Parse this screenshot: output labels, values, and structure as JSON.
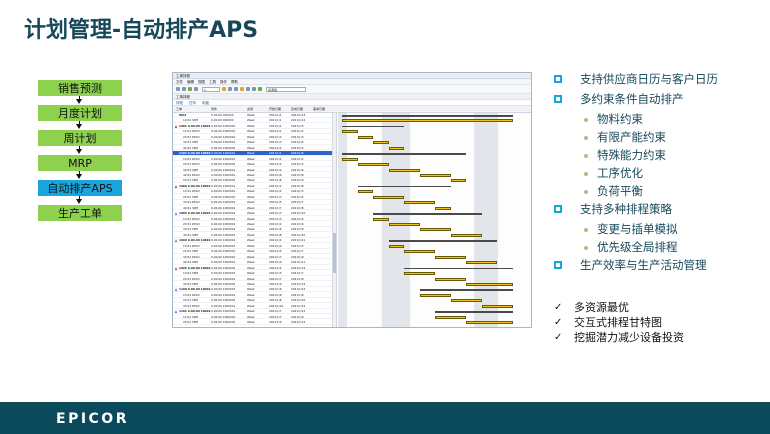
{
  "title": "计划管理-自动排产APS",
  "flow": {
    "steps": [
      "销售预测",
      "月度计划",
      "周计划",
      "MRP",
      "自动排产APS",
      "生产工单"
    ],
    "active_index": 4
  },
  "screenshot": {
    "window_title": "工单排程",
    "menu": [
      "文件",
      "编辑",
      "视图",
      "工具",
      "操作",
      "帮助"
    ],
    "combo1": "1",
    "combo2": "资源组",
    "subtitle": "工单排程",
    "tabs": [
      "排程",
      "甘特",
      "明细"
    ],
    "columns": [
      "工单",
      "零件",
      "资源",
      "开始日期",
      "完成日期",
      "需求日期"
    ],
    "rows": [
      {
        "c0": "WO1",
        "c1": "0-00-00 000000",
        "c2": "Week",
        "c3": "2021/1/1",
        "c4": "2021/1/12",
        "c5": "",
        "parent": true
      },
      {
        "c0": "10 R1 SPM",
        "c1": "0-00-00 000000",
        "c2": "Week",
        "c3": "2021/1/1",
        "c4": "2021/1/12",
        "c5": ""
      },
      {
        "c0": "1081 0-00-00 10001",
        "c1": "0-00-00 1000001",
        "c2": "Week",
        "c3": "2021/1/1",
        "c4": "2021/1/5",
        "c5": "",
        "parent": true,
        "warn": "red"
      },
      {
        "c0": "10 R1 RPG3",
        "c1": "0-00-00 1000001",
        "c2": "Week",
        "c3": "2021/1/1",
        "c4": "2021/1/2",
        "c5": ""
      },
      {
        "c0": "20 R1 RPG3",
        "c1": "0-00-00 1000001",
        "c2": "Week",
        "c3": "2021/1/2",
        "c4": "2021/1/3",
        "c5": ""
      },
      {
        "c0": "30 R1 SPM",
        "c1": "0-00-00 1000001",
        "c2": "Week",
        "c3": "2021/1/3",
        "c4": "2021/1/4",
        "c5": ""
      },
      {
        "c0": "40 R1 SPM",
        "c1": "0-00-00 1000001",
        "c2": "Week",
        "c3": "2021/1/4",
        "c4": "2021/1/5",
        "c5": ""
      },
      {
        "c0": "1102 0-00-00 10001",
        "c1": "0-00-00 1000001",
        "c2": "Week",
        "c3": "2021/1/1",
        "c4": "2021/1/9",
        "c5": "",
        "parent": true,
        "hl": true
      },
      {
        "c0": "10 R1 RPG3",
        "c1": "0-00-00 1000001",
        "c2": "Week",
        "c3": "2021/1/1",
        "c4": "2021/1/2",
        "c5": ""
      },
      {
        "c0": "20 R1 RPG3",
        "c1": "0-00-00 1000001",
        "c2": "Week",
        "c3": "2021/1/2",
        "c4": "2021/1/4",
        "c5": ""
      },
      {
        "c0": "30 R1 SPM",
        "c1": "0-00-00 1000001",
        "c2": "Week",
        "c3": "2021/1/4",
        "c4": "2021/1/6",
        "c5": ""
      },
      {
        "c0": "40 R1 RPG3",
        "c1": "0-00-00 1000001",
        "c2": "Week",
        "c3": "2021/1/6",
        "c4": "2021/1/8",
        "c5": ""
      },
      {
        "c0": "50 R1 SPM",
        "c1": "0-00-00 1000001",
        "c2": "Week",
        "c3": "2021/1/8",
        "c4": "2021/1/9",
        "c5": ""
      },
      {
        "c0": "1080 0-00-00 10001",
        "c1": "0-00-00 1000001",
        "c2": "Week",
        "c3": "2021/1/2",
        "c4": "2021/1/8",
        "c5": "",
        "parent": true,
        "warn": "red"
      },
      {
        "c0": "10 R1 RPG3",
        "c1": "0-00-00 1000001",
        "c2": "Week",
        "c3": "2021/1/2",
        "c4": "2021/1/3",
        "c5": ""
      },
      {
        "c0": "20 R1 SPM",
        "c1": "0-00-00 1000001",
        "c2": "Week",
        "c3": "2021/1/3",
        "c4": "2021/1/5",
        "c5": ""
      },
      {
        "c0": "30 R1 RPG3",
        "c1": "0-00-00 1000001",
        "c2": "Week",
        "c3": "2021/1/5",
        "c4": "2021/1/7",
        "c5": ""
      },
      {
        "c0": "40 R1 SPM",
        "c1": "0-00-00 1000001",
        "c2": "Week",
        "c3": "2021/1/7",
        "c4": "2021/1/8",
        "c5": ""
      },
      {
        "c0": "1085 0-00-00 10001",
        "c1": "0-00-00 1000001",
        "c2": "Week",
        "c3": "2021/1/3",
        "c4": "2021/1/10",
        "c5": "",
        "parent": true,
        "warn": "blue"
      },
      {
        "c0": "10 R1 RPG3",
        "c1": "0-00-00 1000001",
        "c2": "Week",
        "c3": "2021/1/3",
        "c4": "2021/1/4",
        "c5": ""
      },
      {
        "c0": "20 R1 RPG3",
        "c1": "0-00-00 1000001",
        "c2": "Week",
        "c3": "2021/1/4",
        "c4": "2021/1/6",
        "c5": ""
      },
      {
        "c0": "30 R1 SPM",
        "c1": "0-00-00 1000001",
        "c2": "Week",
        "c3": "2021/1/6",
        "c4": "2021/1/8",
        "c5": ""
      },
      {
        "c0": "40 R1 SPM",
        "c1": "0-00-00 1000001",
        "c2": "Week",
        "c3": "2021/1/8",
        "c4": "2021/1/10",
        "c5": ""
      },
      {
        "c0": "1090 0-00-00 10001",
        "c1": "0-00-00 1000001",
        "c2": "Week",
        "c3": "2021/1/4",
        "c4": "2021/1/11",
        "c5": "",
        "parent": true,
        "warn": "blue"
      },
      {
        "c0": "10 R1 RPG3",
        "c1": "0-00-00 1000001",
        "c2": "Week",
        "c3": "2021/1/4",
        "c4": "2021/1/5",
        "c5": ""
      },
      {
        "c0": "20 R1 SPM",
        "c1": "0-00-00 1000001",
        "c2": "Week",
        "c3": "2021/1/5",
        "c4": "2021/1/7",
        "c5": ""
      },
      {
        "c0": "30 R1 RPG3",
        "c1": "0-00-00 1000001",
        "c2": "Week",
        "c3": "2021/1/7",
        "c4": "2021/1/9",
        "c5": ""
      },
      {
        "c0": "40 R1 SPM",
        "c1": "0-00-00 1000001",
        "c2": "Week",
        "c3": "2021/1/9",
        "c4": "2021/1/11",
        "c5": ""
      },
      {
        "c0": "1095 0-00-00 10001",
        "c1": "0-00-00 1000001",
        "c2": "Week",
        "c3": "2021/1/5",
        "c4": "2021/1/12",
        "c5": "",
        "parent": true,
        "warn": "red"
      },
      {
        "c0": "10 R1 SPM",
        "c1": "0-00-00 1000001",
        "c2": "Week",
        "c3": "2021/1/5",
        "c4": "2021/1/7",
        "c5": ""
      },
      {
        "c0": "20 R1 RPG3",
        "c1": "0-00-00 1000001",
        "c2": "Week",
        "c3": "2021/1/7",
        "c4": "2021/1/9",
        "c5": ""
      },
      {
        "c0": "30 R1 SPM",
        "c1": "0-00-00 1000001",
        "c2": "Week",
        "c3": "2021/1/9",
        "c4": "2021/1/12",
        "c5": ""
      },
      {
        "c0": "1100 0-00-00 10001",
        "c1": "0-00-00 1000001",
        "c2": "Week",
        "c3": "2021/1/6",
        "c4": "2021/1/12",
        "c5": "",
        "parent": true,
        "warn": "blue"
      },
      {
        "c0": "10 R1 RPG3",
        "c1": "0-00-00 1000001",
        "c2": "Week",
        "c3": "2021/1/6",
        "c4": "2021/1/8",
        "c5": ""
      },
      {
        "c0": "20 R1 SPM",
        "c1": "0-00-00 1000001",
        "c2": "Week",
        "c3": "2021/1/8",
        "c4": "2021/1/10",
        "c5": ""
      },
      {
        "c0": "30 R1 RPG3",
        "c1": "0-00-00 1000001",
        "c2": "Week",
        "c3": "2021/1/10",
        "c4": "2021/1/12",
        "c5": ""
      },
      {
        "c0": "1101 0-00-00 10001",
        "c1": "0-00-00 1000001",
        "c2": "Week",
        "c3": "2021/1/7",
        "c4": "2021/1/12",
        "c5": "",
        "parent": true,
        "warn": "blue"
      },
      {
        "c0": "10 R1 SPM",
        "c1": "0-00-00 1000001",
        "c2": "Week",
        "c3": "2021/1/7",
        "c4": "2021/1/9",
        "c5": ""
      },
      {
        "c0": "20 R1 SPM",
        "c1": "0-00-00 1000001",
        "c2": "Week",
        "c3": "2021/1/9",
        "c4": "2021/1/12",
        "c5": ""
      }
    ]
  },
  "bullets": [
    {
      "text": "支持供应商日历与客户日历",
      "level": 1
    },
    {
      "text": "多约束条件自动排产",
      "level": 1
    },
    {
      "text": "物料约束",
      "level": 2
    },
    {
      "text": "有限产能约束",
      "level": 2
    },
    {
      "text": "特殊能力约束",
      "level": 2
    },
    {
      "text": "工序优化",
      "level": 2
    },
    {
      "text": "负荷平衡",
      "level": 2
    },
    {
      "text": "支持多种排程策略",
      "level": 1
    },
    {
      "text": "变更与插单模拟",
      "level": 2
    },
    {
      "text": "优先级全局排程",
      "level": 2
    },
    {
      "text": "生产效率与生产活动管理",
      "level": 1
    }
  ],
  "checks": [
    "多资源最优",
    "交互式排程甘特图",
    "挖掘潜力减少设备投资"
  ],
  "footer": {
    "logo": "epicor"
  },
  "colors": {
    "title": "#17485a",
    "flow_box": "#8ed14f",
    "flow_active": "#1aa6db",
    "footer": "#0b4a5b",
    "gantt_bar": "#f1c40f",
    "bullet_square": "#1aa6db"
  }
}
